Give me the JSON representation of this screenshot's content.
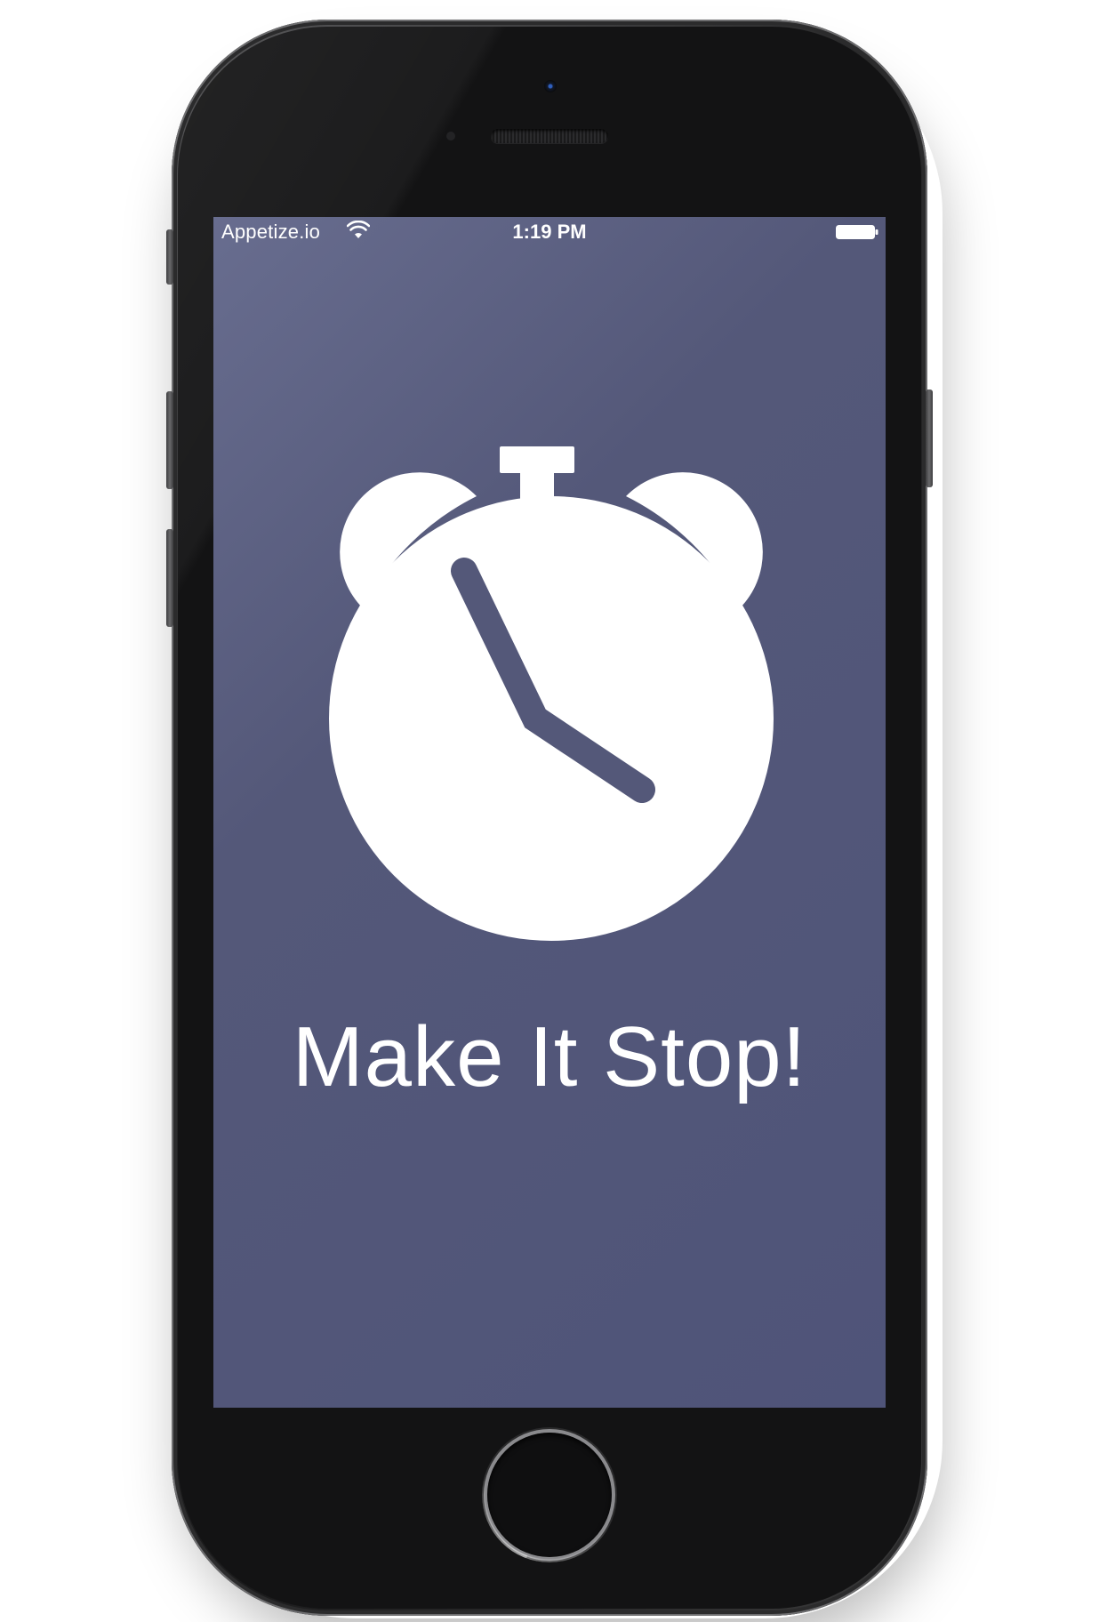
{
  "status_bar": {
    "carrier": "Appetize.io",
    "time": "1:19 PM",
    "icons": [
      "wifi-icon",
      "battery-icon"
    ]
  },
  "main": {
    "icon": "alarm-clock-icon",
    "title": "Make It Stop!"
  },
  "colors": {
    "screen_background": "#545879",
    "foreground": "#ffffff",
    "device_body": "#131314"
  }
}
